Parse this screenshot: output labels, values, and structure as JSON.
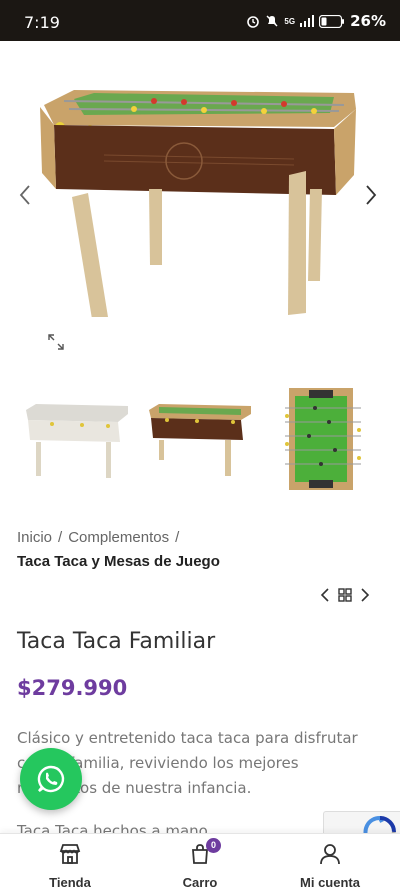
{
  "status_bar": {
    "time": "7:19",
    "network": "5G",
    "battery": "26%"
  },
  "breadcrumb": {
    "items": [
      "Inicio",
      "Complementos"
    ],
    "separator": "/",
    "current": "Taca Taca y Mesas de Juego"
  },
  "product": {
    "title": "Taca Taca Familiar",
    "price": "$279.990",
    "description": "Clásico y entretenido taca taca para disfrutar con tu familia, reviviendo los mejores momentos de nuestra infancia.",
    "description_extra": "Taca Taca hechos a mano"
  },
  "bottom_nav": {
    "items": [
      {
        "label": "Tienda",
        "icon": "store-icon"
      },
      {
        "label": "Carro",
        "icon": "cart-icon",
        "badge": "0"
      },
      {
        "label": "Mi cuenta",
        "icon": "user-icon"
      }
    ]
  },
  "colors": {
    "accent": "#6e3c9f",
    "whatsapp": "#25c75e",
    "status_bar": "#1b1713"
  }
}
